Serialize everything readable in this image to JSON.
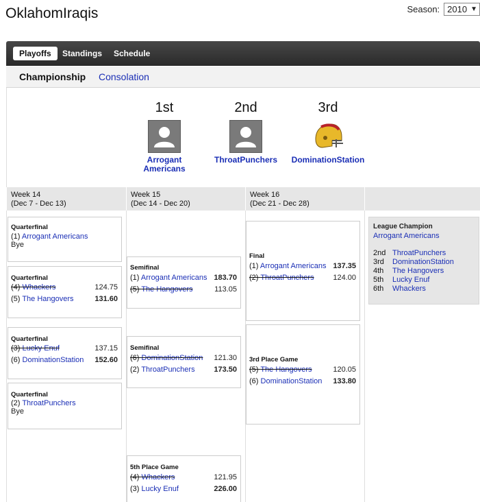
{
  "header": {
    "title": "OklahomIraqis",
    "season_label": "Season:",
    "season_value": "2010"
  },
  "nav": {
    "tabs": [
      "Playoffs",
      "Standings",
      "Schedule"
    ]
  },
  "subnav": {
    "tabs": [
      "Championship",
      "Consolation"
    ]
  },
  "podium": [
    {
      "rank": "1st",
      "name_line1": "Arrogant",
      "name_line2": "Americans",
      "icon": "default-avatar-icon"
    },
    {
      "rank": "2nd",
      "name_line1": "ThroatPunchers",
      "name_line2": "",
      "icon": "default-avatar-icon"
    },
    {
      "rank": "3rd",
      "name_line1": "DominationStation",
      "name_line2": "",
      "icon": "football-helmet-icon"
    }
  ],
  "weeks": [
    {
      "label": "Week 14",
      "range": "(Dec 7 - Dec 13)"
    },
    {
      "label": "Week 15",
      "range": "(Dec 14 - Dec 20)"
    },
    {
      "label": "Week 16",
      "range": "(Dec 21 - Dec 28)"
    }
  ],
  "matchups": {
    "qf1": {
      "label": "Quarterfinal",
      "team1": {
        "seed": "(1)",
        "name": "Arrogant Americans"
      },
      "bye": "Bye"
    },
    "qf2": {
      "label": "Quarterfinal",
      "team1": {
        "seed": "(4)",
        "name": "Whackers",
        "score": "124.75"
      },
      "team2": {
        "seed": "(5)",
        "name": "The Hangovers",
        "score": "131.60"
      }
    },
    "qf3": {
      "label": "Quarterfinal",
      "team1": {
        "seed": "(3)",
        "name": "Lucky Enuf",
        "score": "137.15"
      },
      "team2": {
        "seed": "(6)",
        "name": "DominationStation",
        "score": "152.60"
      }
    },
    "qf4": {
      "label": "Quarterfinal",
      "team1": {
        "seed": "(2)",
        "name": "ThroatPunchers"
      },
      "bye": "Bye"
    },
    "sf1": {
      "label": "Semifinal",
      "team1": {
        "seed": "(1)",
        "name": "Arrogant Americans",
        "score": "183.70"
      },
      "team2": {
        "seed": "(5)",
        "name": "The Hangovers",
        "score": "113.05"
      }
    },
    "sf2": {
      "label": "Semifinal",
      "team1": {
        "seed": "(6)",
        "name": "DominationStation",
        "score": "121.30"
      },
      "team2": {
        "seed": "(2)",
        "name": "ThroatPunchers",
        "score": "173.50"
      }
    },
    "fifth": {
      "label": "5th Place Game",
      "team1": {
        "seed": "(4)",
        "name": "Whackers",
        "score": "121.95"
      },
      "team2": {
        "seed": "(3)",
        "name": "Lucky Enuf",
        "score": "226.00"
      }
    },
    "final": {
      "label": "Final",
      "team1": {
        "seed": "(1)",
        "name": "Arrogant Americans",
        "score": "137.35"
      },
      "team2": {
        "seed": "(2)",
        "name": "ThroatPunchers",
        "score": "124.00"
      }
    },
    "third": {
      "label": "3rd Place Game",
      "team1": {
        "seed": "(5)",
        "name": "The Hangovers",
        "score": "120.05"
      },
      "team2": {
        "seed": "(6)",
        "name": "DominationStation",
        "score": "133.80"
      }
    }
  },
  "league": {
    "heading": "League Champion",
    "champion": "Arrogant Americans",
    "places": [
      {
        "place": "2nd",
        "team": "ThroatPunchers"
      },
      {
        "place": "3rd",
        "team": "DominationStation"
      },
      {
        "place": "4th",
        "team": "The Hangovers"
      },
      {
        "place": "5th",
        "team": "Lucky Enuf"
      },
      {
        "place": "6th",
        "team": "Whackers"
      }
    ]
  },
  "colors": {
    "link": "#1a2eb5",
    "navbar": "#333333",
    "header_bg": "#e6e6e6"
  }
}
